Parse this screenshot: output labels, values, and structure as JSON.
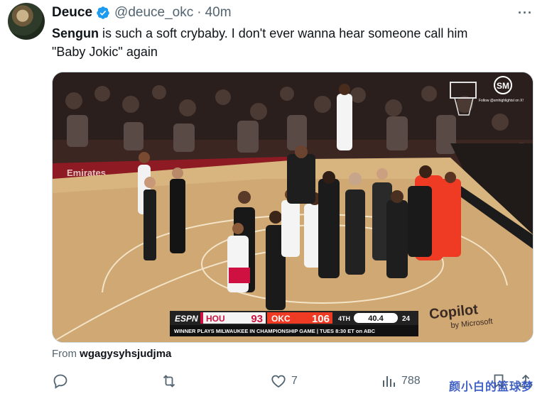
{
  "author": {
    "display_name": "Deuce",
    "handle": "@deuce_okc",
    "separator": "·",
    "time": "40m"
  },
  "tweet": {
    "text_bold": "Sengun",
    "text_rest_line1": " is such a soft crybaby. I don't ever wanna hear someone call him",
    "text_line2": "\"Baby Jokic\" again"
  },
  "media": {
    "logo_text": "SM",
    "follow_text": "Follow @smhighlightsl on X!",
    "scoreboard": {
      "network": "ESPN",
      "home_team": "HOU",
      "home_score": "93",
      "away_team": "OKC",
      "away_score": "106",
      "period": "4TH",
      "clock": "40.4",
      "shot_clock": "24",
      "banner": "WINNER PLAYS MILWAUKEE IN CHAMPIONSHIP GAME | TUES 8:30 ET on ABC"
    },
    "court_ad": "Copilot",
    "court_ad_sub": "by Microsoft",
    "sideline_ad": "Emirates"
  },
  "source": {
    "prefix": "From",
    "name": "wgagysyhsjudjma"
  },
  "actions": {
    "likes": "7",
    "views": "788"
  },
  "watermark": "颜小白的篮球梦",
  "colors": {
    "verified": "#1d9bf0",
    "text_secondary": "#536471",
    "hou_red": "#ce1141",
    "okc_orange": "#ef3b24"
  }
}
